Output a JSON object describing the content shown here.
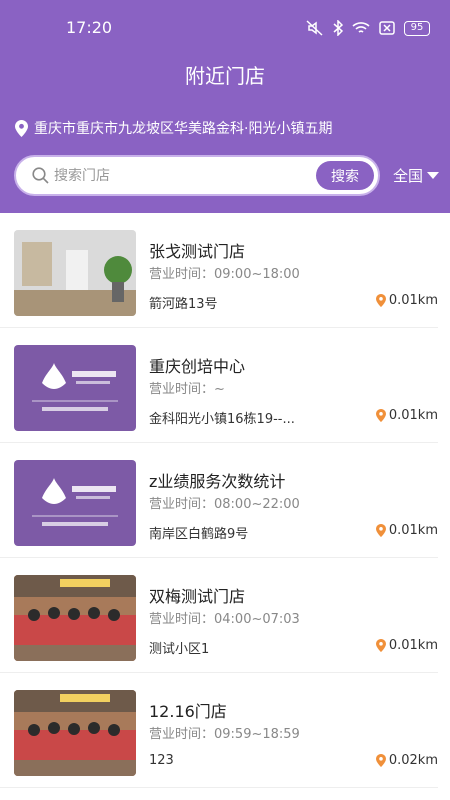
{
  "status_bar": {
    "time": "17:20",
    "battery": "95"
  },
  "header": {
    "title": "附近门店",
    "location": "重庆市重庆市九龙坡区华美路金科·阳光小镇五期",
    "search": {
      "placeholder": "搜索门店",
      "button_label": "搜索"
    },
    "region": "全国"
  },
  "colors": {
    "brand": "#8a62c3",
    "pin": "#f0903a"
  },
  "stores": [
    {
      "name": "张戈测试门店",
      "hours": "营业时间：09:00~18:00",
      "address": "箭河路13号",
      "distance": "0.01km",
      "image": "room"
    },
    {
      "name": "重庆创培中心",
      "hours": "营业时间：~",
      "address": "金科阳光小镇16栋19--...",
      "distance": "0.01km",
      "image": "brand"
    },
    {
      "name": "z业绩服务次数统计",
      "hours": "营业时间：08:00~22:00",
      "address": "南岸区白鹤路9号",
      "distance": "0.01km",
      "image": "brand"
    },
    {
      "name": "双梅测试门店",
      "hours": "营业时间：04:00~07:03",
      "address": "测试小区1",
      "distance": "0.01km",
      "image": "group"
    },
    {
      "name": "12.16门店",
      "hours": "营业时间：09:59~18:59",
      "address": "123",
      "distance": "0.02km",
      "image": "group"
    }
  ]
}
